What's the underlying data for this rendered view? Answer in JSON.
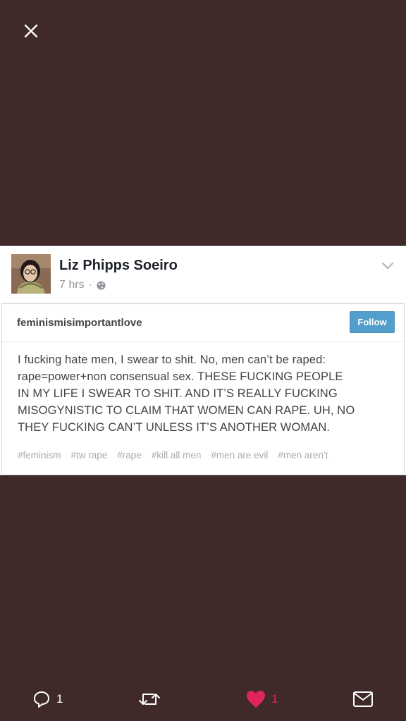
{
  "viewer": {
    "close_icon": "close-icon"
  },
  "post": {
    "author_name": "Liz Phipps Soeiro",
    "timestamp": "7 hrs",
    "separator": "·",
    "privacy_icon": "globe-icon",
    "menu_icon": "chevron-down-icon"
  },
  "tumblr": {
    "username": "feminismisimportantlove",
    "follow_label": "Follow",
    "body_lines": [
      "I fucking hate men, I swear to shit. No, men can’t be raped:",
      "rape=power+non consensual sex. THESE FUCKING PEOPLE",
      "IN MY LIFE I SWEAR TO SHIT. AND IT’S REALLY FUCKING",
      "MISOGYNISTIC TO CLAIM THAT WOMEN CAN RAPE. UH, NO",
      "THEY FUCKING CAN’T UNLESS IT’S ANOTHER WOMAN."
    ],
    "tags": [
      "#feminism",
      "#tw rape",
      "#rape",
      "#kill all men",
      "#men are evil",
      "#men aren't"
    ]
  },
  "actions": {
    "reply_count": "1",
    "retweet_count": "",
    "like_count": "1",
    "colors": {
      "like": "#e0245e",
      "icon": "#ffffff"
    }
  }
}
